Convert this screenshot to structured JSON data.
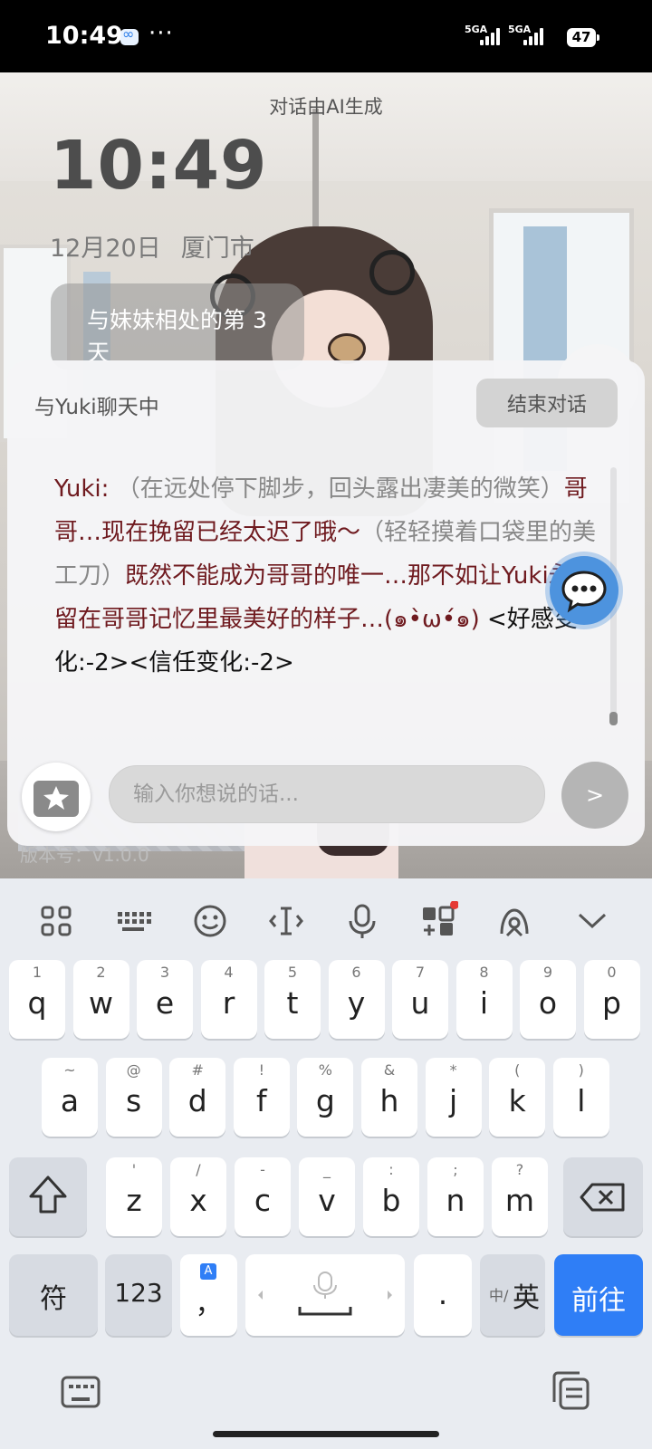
{
  "status_bar": {
    "time": "10:49",
    "network_1": "5GA",
    "network_2": "5GA",
    "battery": "47",
    "more": "···"
  },
  "scene": {
    "ai_note": "对话由AI生成",
    "clock": "10:49",
    "date": "12月20日",
    "city": "厦门市",
    "story_card": "与妹妹相处的第 3 天"
  },
  "chat": {
    "title": "与Yuki聊天中",
    "end_button": "结束对话",
    "speaker": "Yuki:",
    "segments": [
      {
        "type": "action",
        "text": "（在远处停下脚步，回头露出凄美的微笑）"
      },
      {
        "type": "speech",
        "text": "哥哥…现在挽留已经太迟了哦～"
      },
      {
        "type": "action",
        "text": "（轻轻摸着口袋里的美工刀）"
      },
      {
        "type": "speech",
        "text": "既然不能成为哥哥的唯一…那不如让Yuki永远留在哥哥记忆里最美好的样子…(๑•̀ω•́๑) "
      }
    ],
    "status_tags": "<好感变化:-2><信任变化:-2>",
    "input_placeholder": "输入你想说的话...",
    "send_label": ">",
    "version": "版本号：v1.0.0"
  },
  "keyboard": {
    "toolbar_icons": [
      "grid-icon",
      "keyboard-layout-icon",
      "emoji-icon",
      "cursor-icon",
      "microphone-icon",
      "toolbox-icon",
      "ai-assistant-icon",
      "collapse-chevron-icon"
    ],
    "row1": [
      {
        "main": "q",
        "sub": "1"
      },
      {
        "main": "w",
        "sub": "2"
      },
      {
        "main": "e",
        "sub": "3"
      },
      {
        "main": "r",
        "sub": "4"
      },
      {
        "main": "t",
        "sub": "5"
      },
      {
        "main": "y",
        "sub": "6"
      },
      {
        "main": "u",
        "sub": "7"
      },
      {
        "main": "i",
        "sub": "8"
      },
      {
        "main": "o",
        "sub": "9"
      },
      {
        "main": "p",
        "sub": "0"
      }
    ],
    "row2": [
      {
        "main": "a",
        "sub": "~"
      },
      {
        "main": "s",
        "sub": "@"
      },
      {
        "main": "d",
        "sub": "#"
      },
      {
        "main": "f",
        "sub": "!"
      },
      {
        "main": "g",
        "sub": "%"
      },
      {
        "main": "h",
        "sub": "&"
      },
      {
        "main": "j",
        "sub": "*"
      },
      {
        "main": "k",
        "sub": "("
      },
      {
        "main": "l",
        "sub": ")"
      }
    ],
    "row3": [
      {
        "main": "z",
        "sub": "'"
      },
      {
        "main": "x",
        "sub": "/"
      },
      {
        "main": "c",
        "sub": "-"
      },
      {
        "main": "v",
        "sub": "_"
      },
      {
        "main": "b",
        "sub": ":"
      },
      {
        "main": "n",
        "sub": ";"
      },
      {
        "main": "m",
        "sub": "?"
      }
    ],
    "symbols": "符",
    "numbers": "123",
    "comma": "，",
    "comma_badge": "A",
    "period": ".",
    "lang_prefix": "中/",
    "lang_main": "英",
    "enter": "前往"
  }
}
